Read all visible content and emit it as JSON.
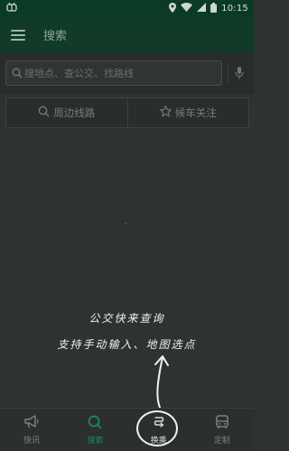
{
  "status_bar": {
    "left_icon": "bug-icon",
    "time": "10:15",
    "icons": [
      "location-icon",
      "wifi-icon",
      "signal-icon",
      "battery-icon"
    ]
  },
  "app_bar": {
    "title": "搜索"
  },
  "search": {
    "placeholder": "搜地点、查公交、找路线"
  },
  "quick_actions": [
    {
      "label": "周边线路",
      "icon": "search-icon"
    },
    {
      "label": "候车关注",
      "icon": "star-icon"
    }
  ],
  "hint": {
    "line1": "公交快来查询",
    "line2": "支持手动输入、地图选点"
  },
  "bottom_nav": [
    {
      "label": "快讯",
      "icon": "megaphone-icon",
      "active": false
    },
    {
      "label": "搜索",
      "icon": "search-icon",
      "active": true
    },
    {
      "label": "换乘",
      "icon": "transfer-icon",
      "active": false
    },
    {
      "label": "定制",
      "icon": "bus-icon",
      "active": false
    }
  ],
  "colors": {
    "accent": "#1c8a57",
    "app_bar": "#113a28",
    "status_bar": "#0b3a26"
  }
}
